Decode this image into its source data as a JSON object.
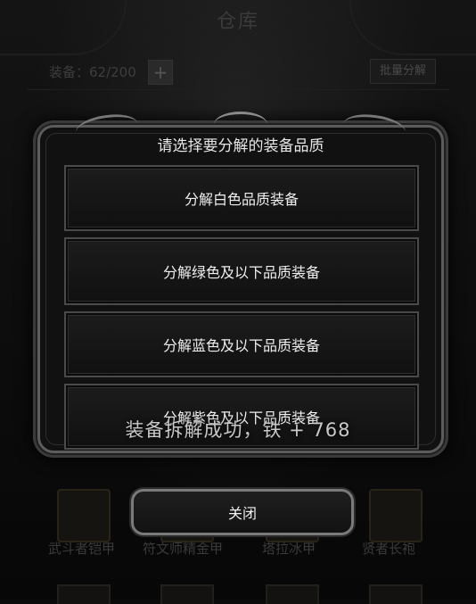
{
  "background": {
    "title": "仓库",
    "equip_count": "装备：62/200",
    "add_label": "+",
    "batch_decompose": "批量分解",
    "items": [
      "武斗者铠甲",
      "符文师精金甲",
      "塔拉冰甲",
      "贤者长袍"
    ]
  },
  "dialog": {
    "title": "请选择要分解的装备品质",
    "options": [
      "分解白色品质装备",
      "分解绿色及以下品质装备",
      "分解蓝色及以下品质装备",
      "分解紫色及以下品质装备"
    ],
    "close_label": "关闭"
  },
  "toast": "装备拆解成功，铁 + 768"
}
